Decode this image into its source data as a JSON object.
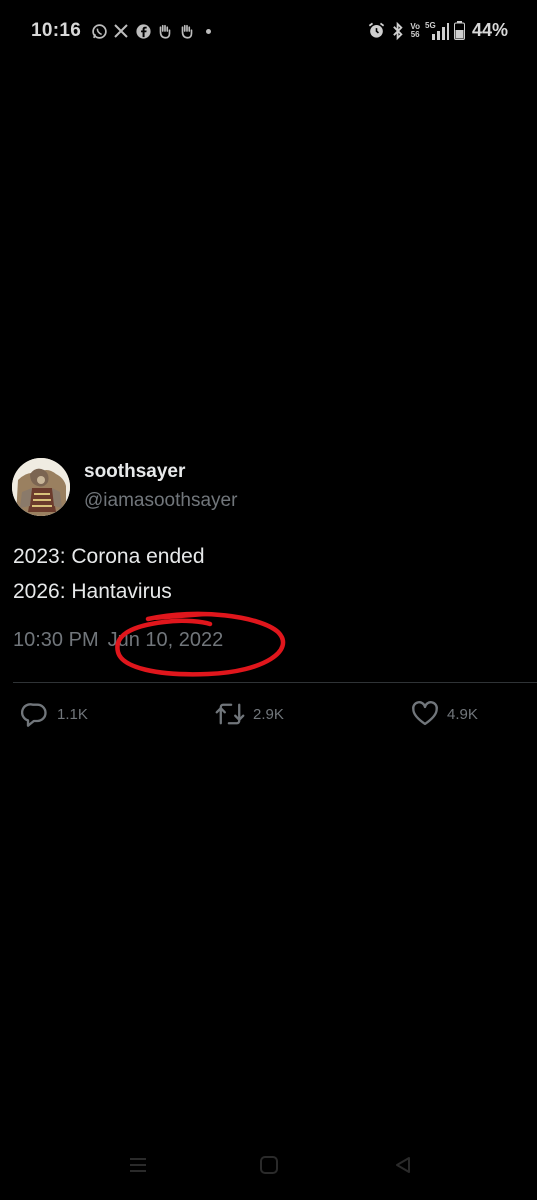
{
  "status_bar": {
    "time": "10:16",
    "battery": "44%",
    "network_top": "Vo",
    "network_bottom": "56",
    "network_type": "5G",
    "left_icons": [
      "whatsapp-icon",
      "x-icon",
      "facebook-icon",
      "wave-hand-icon",
      "wave-hand-icon"
    ],
    "right_icons": [
      "alarm-icon",
      "bluetooth-icon",
      "volte-icon",
      "signal-icon",
      "battery-icon"
    ]
  },
  "tweet": {
    "author_name": "soothsayer",
    "author_handle": "@iamasoothsayer",
    "lines": [
      "2023: Corona ended",
      "2026: Hantavirus"
    ],
    "time": "10:30 PM",
    "date": "Jun 10, 2022",
    "annotation_color": "#e0161c"
  },
  "actions": {
    "reply_count": "1.1K",
    "retweet_count": "2.9K",
    "like_count": "4.9K"
  },
  "colors": {
    "background": "#000000",
    "primary_text": "#e7e9ea",
    "secondary_text": "#71767b",
    "divider": "#2f3336"
  }
}
